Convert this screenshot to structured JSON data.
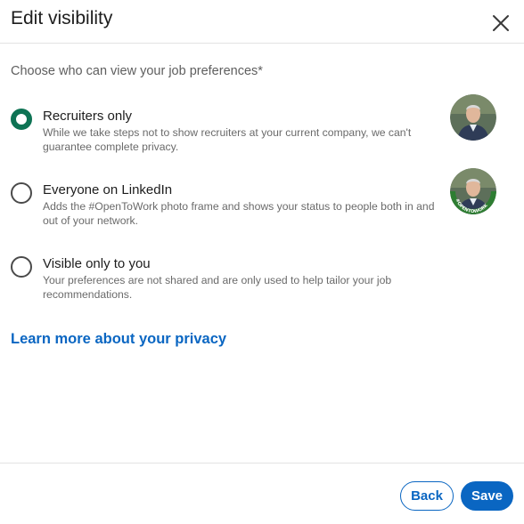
{
  "dialog": {
    "title": "Edit visibility",
    "close_icon": "close-icon"
  },
  "main": {
    "subtitle": "Choose who can view your job preferences*",
    "options": [
      {
        "label": "Recruiters only",
        "description": "While we take steps not to show recruiters at your current company, we can't guarantee complete privacy.",
        "selected": true,
        "avatar": "profile-photo"
      },
      {
        "label": "Everyone on LinkedIn",
        "description": "Adds the #OpenToWork photo frame and shows your status to people both in and out of your network.",
        "selected": false,
        "avatar": "profile-photo-opentowork-frame",
        "frame_text": "#OPENTOWORK"
      },
      {
        "label": "Visible only to you",
        "description": "Your preferences are not shared and are only used to help tailor your job recommendations.",
        "selected": false
      }
    ],
    "privacy_link": "Learn more about your privacy"
  },
  "footer": {
    "back_label": "Back",
    "save_label": "Save"
  },
  "colors": {
    "accent": "#0a66c2",
    "radio_selected": "#0e7354",
    "opentowork_frame": "#2e7d32"
  }
}
